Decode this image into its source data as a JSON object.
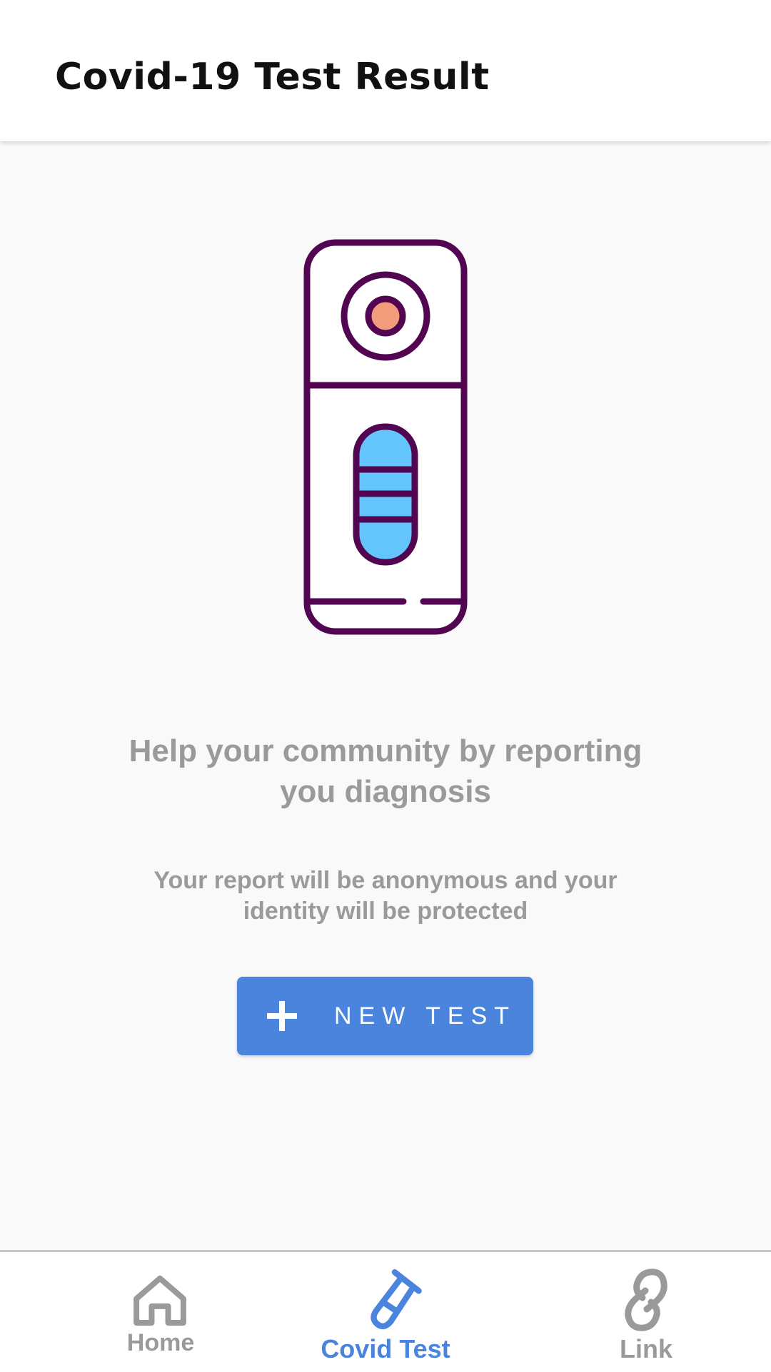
{
  "app_bar": {
    "title": "Covid-19 Test Result"
  },
  "main": {
    "illustration_icon": "covid-test-kit-icon",
    "headline": "Help your community by reporting you diagnosis",
    "subtext": "Your report will be anonymous and your identity will be protected",
    "new_test_button": {
      "icon": "plus-icon",
      "label": "NEW TEST"
    }
  },
  "bottom_nav": {
    "items": [
      {
        "label": "Home",
        "icon": "home-icon",
        "active": false
      },
      {
        "label": "Covid Test",
        "icon": "test-tube-icon",
        "active": true
      },
      {
        "label": "Link",
        "icon": "link-icon",
        "active": false
      }
    ]
  },
  "colors": {
    "accent": "#4b84dd",
    "inactive": "#9a9a9a",
    "illustration_outline": "#520550",
    "illustration_strip": "#63c5fb",
    "illustration_dot": "#f39c7c"
  }
}
